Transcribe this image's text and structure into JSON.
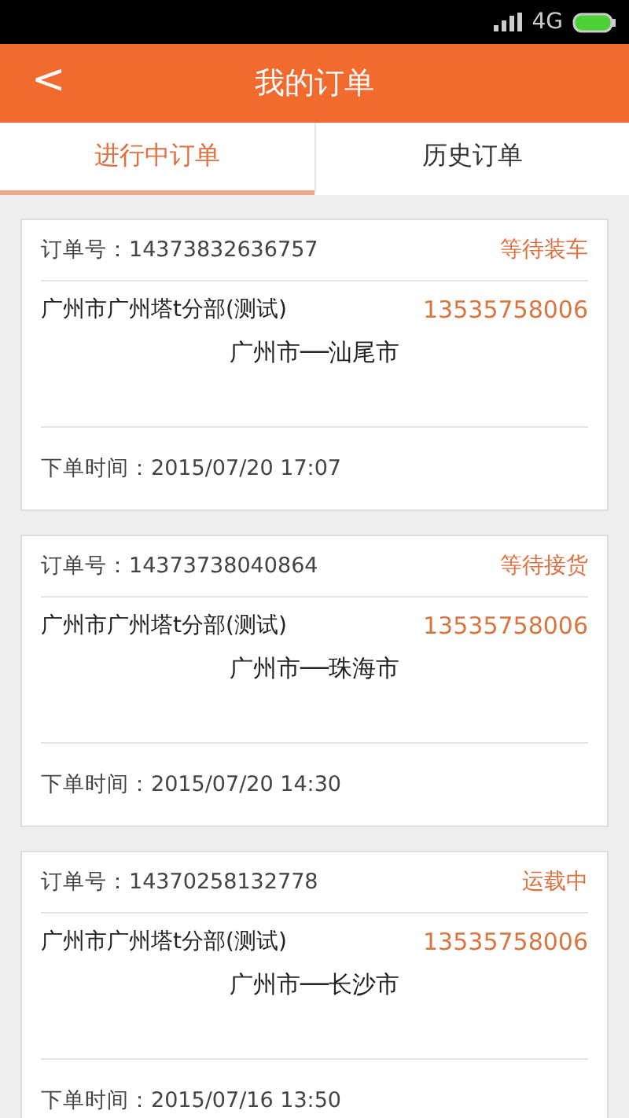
{
  "status_bar": {
    "network": "4G"
  },
  "header": {
    "title": "我的订单",
    "back": "<"
  },
  "tabs": [
    {
      "label": "进行中订单",
      "selected": true
    },
    {
      "label": "历史订单",
      "selected": false
    }
  ],
  "orders": [
    {
      "number_label": "订单号：14373832636757",
      "status": "等待装车",
      "sender": "广州市广州塔t分部(测试)",
      "phone": "13535758006",
      "route": "广州市──汕尾市",
      "time": "下单时间：2015/07/20 17:07"
    },
    {
      "number_label": "订单号：14373738040864",
      "status": "等待接货",
      "sender": "广州市广州塔t分部(测试)",
      "phone": "13535758006",
      "route": "广州市──珠海市",
      "time": "下单时间：2015/07/20 14:30"
    },
    {
      "number_label": "订单号：14370258132778",
      "status": "运载中",
      "sender": "广州市广州塔t分部(测试)",
      "phone": "13535758006",
      "route": "广州市──长沙市",
      "time": "下单时间：2015/07/16 13:50"
    }
  ]
}
